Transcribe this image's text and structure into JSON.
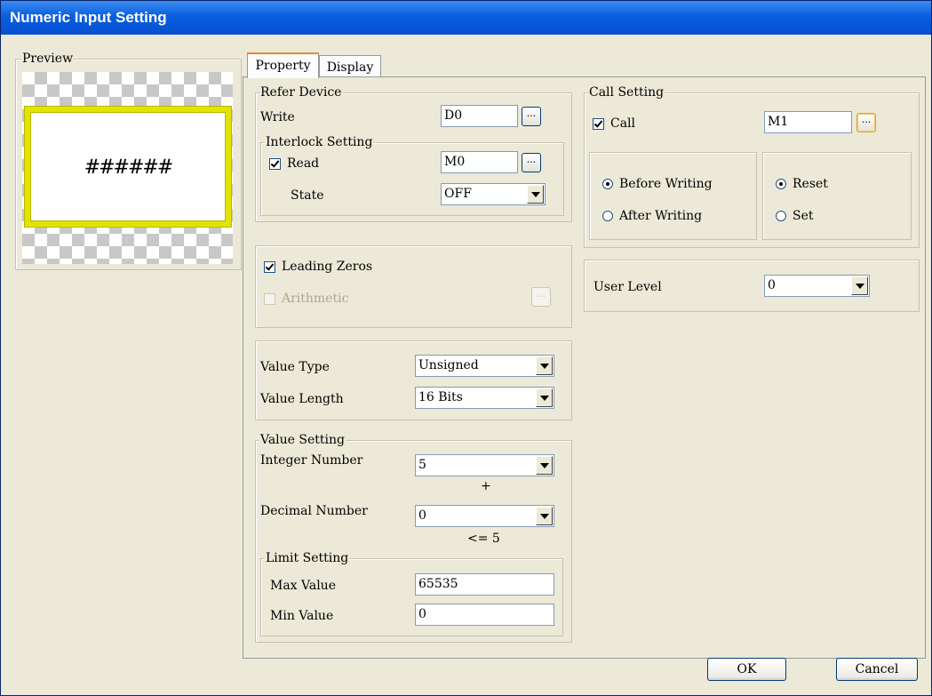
{
  "window": {
    "title": "Numeric Input Setting"
  },
  "preview": {
    "legend": "Preview",
    "sample_text": "######"
  },
  "tabs": [
    {
      "label": "Property"
    },
    {
      "label": "Display"
    }
  ],
  "refer_device": {
    "legend": "Refer Device",
    "write_label": "Write",
    "write_value": "D0",
    "browse_label": "...",
    "interlock": {
      "legend": "Interlock Setting",
      "read_label": "Read",
      "read_checked": true,
      "read_value": "M0",
      "state_label": "State",
      "state_value": "OFF"
    }
  },
  "options": {
    "leading_zeros_label": "Leading Zeros",
    "leading_zeros_checked": true,
    "arithmetic_label": "Arithmetic",
    "arithmetic_checked": false
  },
  "value": {
    "type_label": "Value Type",
    "type_value": "Unsigned",
    "length_label": "Value Length",
    "length_value": "16 Bits"
  },
  "value_setting": {
    "legend": "Value Setting",
    "integer_label": "Integer Number",
    "integer_value": "5",
    "plus_text": "+",
    "decimal_label": "Decimal Number",
    "decimal_value": "0",
    "constraint_text": "<= 5",
    "limit": {
      "legend": "Limit Setting",
      "max_label": "Max Value",
      "max_value": "65535",
      "min_label": "Min Value",
      "min_value": "0"
    }
  },
  "call_setting": {
    "legend": "Call Setting",
    "call_label": "Call",
    "call_checked": true,
    "call_value": "M1",
    "timing_options": [
      {
        "label": "Before Writing",
        "selected": true
      },
      {
        "label": "After Writing",
        "selected": false
      }
    ],
    "action_options": [
      {
        "label": "Reset",
        "selected": true
      },
      {
        "label": "Set",
        "selected": false
      }
    ]
  },
  "user_level": {
    "label": "User Level",
    "value": "0"
  },
  "buttons": {
    "ok": "OK",
    "cancel": "Cancel"
  },
  "colors": {
    "title_bar": "#0a5ee0",
    "preview_frame": "#e3e300",
    "dialog_bg": "#ece9d8"
  }
}
